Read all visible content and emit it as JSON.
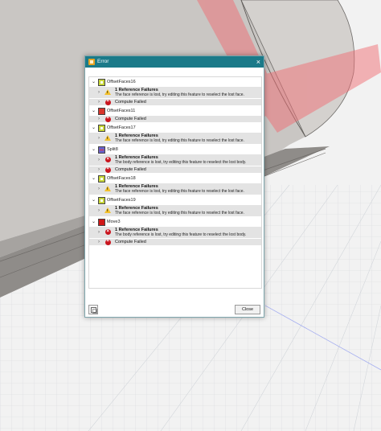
{
  "dialog": {
    "title": "Error",
    "close_symbol": "×",
    "close_button_label": "Close"
  },
  "features": [
    {
      "name": "OffsetFaces16",
      "icon": "offset-faces-icon",
      "messages": [
        {
          "type": "warning",
          "title": "1 Reference Failures",
          "text": "The face reference is lost, try editing this feature to reselect the lost face."
        },
        {
          "type": "error",
          "title": "Compute Failed",
          "text": ""
        }
      ]
    },
    {
      "name": "OffsetFaces11",
      "icon": "offset-faces-error-icon",
      "messages": [
        {
          "type": "error",
          "title": "Compute Failed",
          "text": ""
        }
      ]
    },
    {
      "name": "OffsetFaces17",
      "icon": "offset-faces-icon",
      "messages": [
        {
          "type": "warning",
          "title": "1 Reference Failures",
          "text": "The face reference is lost, try editing this feature to reselect the lost face."
        }
      ]
    },
    {
      "name": "Split8",
      "icon": "split-body-icon",
      "messages": [
        {
          "type": "error",
          "title": "1 Reference Failures",
          "text": "The body reference is lost, try editing this feature to reselect the lost body."
        },
        {
          "type": "error",
          "title": "Compute Failed",
          "text": ""
        }
      ]
    },
    {
      "name": "OffsetFaces18",
      "icon": "offset-faces-icon",
      "messages": [
        {
          "type": "warning",
          "title": "1 Reference Failures",
          "text": "The face reference is lost, try editing this feature to reselect the lost face."
        }
      ]
    },
    {
      "name": "OffsetFaces19",
      "icon": "offset-faces-icon",
      "messages": [
        {
          "type": "warning",
          "title": "1 Reference Failures",
          "text": "The face reference is lost, try editing this feature to reselect the lost face."
        }
      ]
    },
    {
      "name": "Move3",
      "icon": "move-icon",
      "messages": [
        {
          "type": "error",
          "title": "1 Reference Failures",
          "text": "The body reference is lost, try editing this feature to reselect the lost body."
        },
        {
          "type": "error",
          "title": "Compute Failed",
          "text": ""
        }
      ]
    }
  ],
  "colors": {
    "titlebar": "#1b7a89",
    "warning": "#f2c02c",
    "error": "#c9151e",
    "message_bg": "#e3e3e3"
  }
}
